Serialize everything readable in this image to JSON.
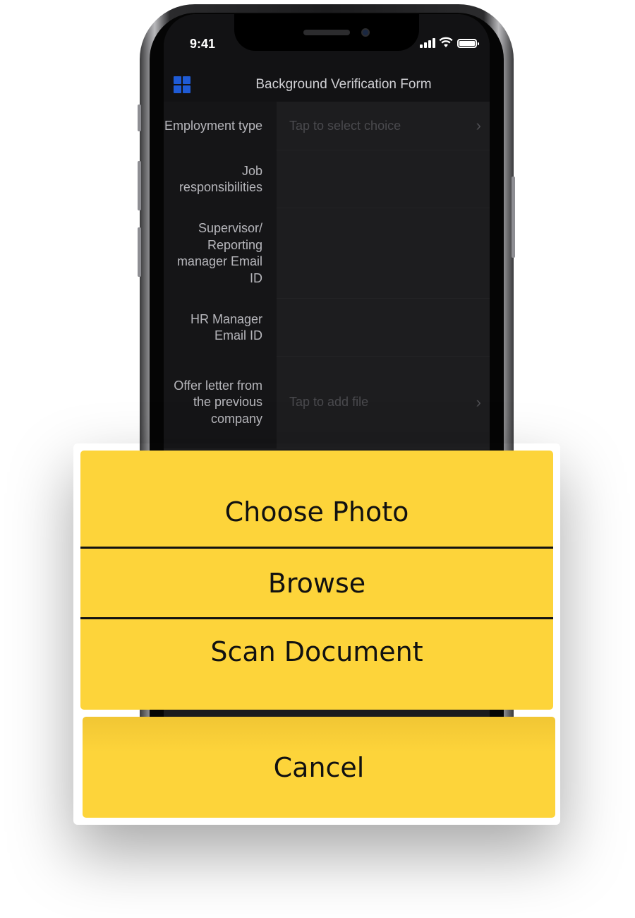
{
  "status_bar": {
    "time": "9:41"
  },
  "nav": {
    "title": "Background Verification Form",
    "icon": "grid-icon"
  },
  "form": {
    "rows": [
      {
        "label": "Employment type",
        "value_placeholder": "Tap to select choice",
        "has_chevron": true
      },
      {
        "label": "Job responsibilities",
        "value_placeholder": "",
        "has_chevron": false
      },
      {
        "label": "Supervisor/ Reporting manager Email ID",
        "value_placeholder": "",
        "has_chevron": false
      },
      {
        "label": "HR Manager Email ID",
        "value_placeholder": "",
        "has_chevron": false
      },
      {
        "label": "Offer letter from the previous company",
        "value_placeholder": "Tap to add file",
        "has_chevron": true
      }
    ]
  },
  "action_sheet": {
    "options": [
      "Choose Photo",
      "Browse",
      "Scan Document"
    ],
    "cancel_label": "Cancel",
    "accent_color": "#fdd43a"
  },
  "colors": {
    "screen_bg": "#1b1b1d",
    "nav_icon": "#1f5bd6",
    "sheet_text": "#111111"
  }
}
